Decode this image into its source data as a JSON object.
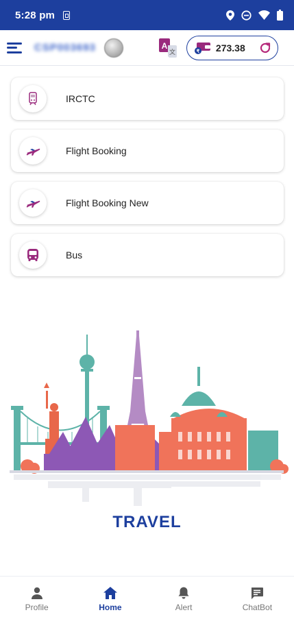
{
  "status_bar": {
    "time": "5:28 pm",
    "icons": [
      "sim-icon",
      "location-icon",
      "dnd-icon",
      "wifi-icon",
      "battery-icon"
    ]
  },
  "header": {
    "user_id": "CSP003693",
    "wallet_balance": "273.38",
    "brand_color": "#1d3f9e"
  },
  "services": [
    {
      "label": "IRCTC",
      "icon": "train-icon"
    },
    {
      "label": "Flight Booking",
      "icon": "airplane-icon"
    },
    {
      "label": "Flight Booking New",
      "icon": "airplane-icon"
    },
    {
      "label": "Bus",
      "icon": "bus-icon"
    }
  ],
  "banner": {
    "title": "TRAVEL"
  },
  "bottom_nav": [
    {
      "label": "Profile",
      "icon": "person-icon",
      "active": false
    },
    {
      "label": "Home",
      "icon": "home-icon",
      "active": true
    },
    {
      "label": "Alert",
      "icon": "bell-icon",
      "active": false
    },
    {
      "label": "ChatBot",
      "icon": "chat-icon",
      "active": false
    }
  ]
}
